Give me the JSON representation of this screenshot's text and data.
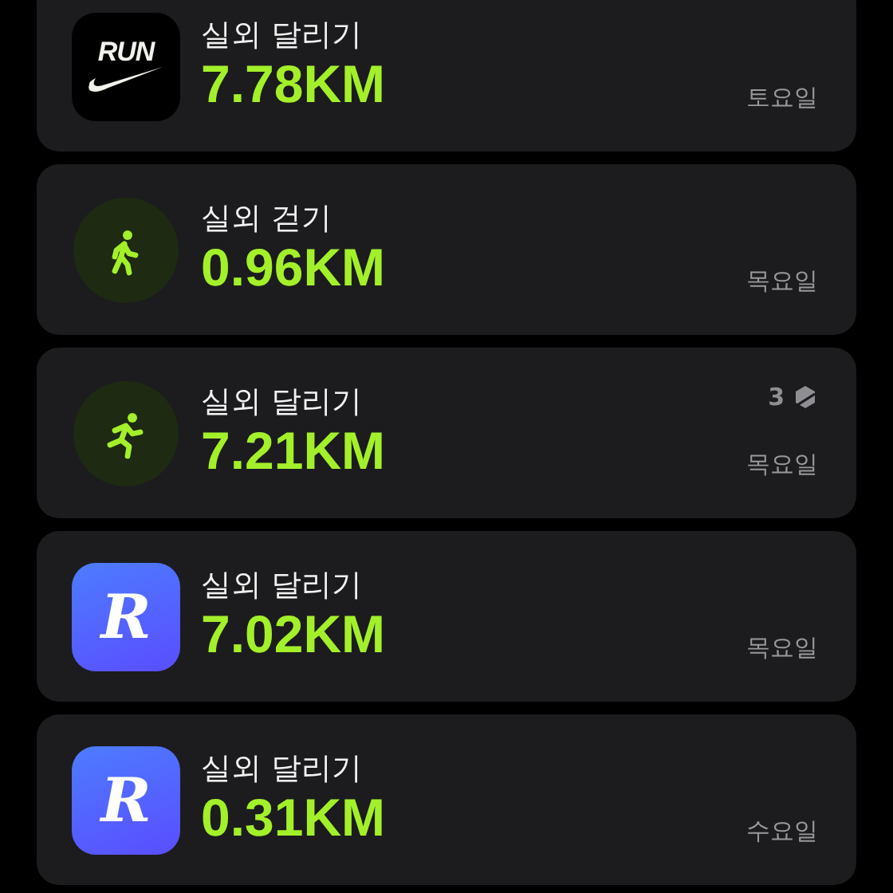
{
  "workouts": [
    {
      "icon": {
        "kind": "wordmark",
        "label": "RUN"
      },
      "title": "실외 달리기",
      "distance": "7.78KM",
      "day": "토요일"
    },
    {
      "icon": {
        "kind": "walk"
      },
      "title": "실외 걷기",
      "distance": "0.96KM",
      "day": "목요일"
    },
    {
      "icon": {
        "kind": "run"
      },
      "title": "실외 달리기",
      "distance": "7.21KM",
      "day": "목요일",
      "badge": "3"
    },
    {
      "icon": {
        "kind": "letter",
        "label": "R"
      },
      "title": "실외 달리기",
      "distance": "7.02KM",
      "day": "목요일"
    },
    {
      "icon": {
        "kind": "letter",
        "label": "R"
      },
      "title": "실외 달리기",
      "distance": "0.31KM",
      "day": "수요일"
    }
  ]
}
